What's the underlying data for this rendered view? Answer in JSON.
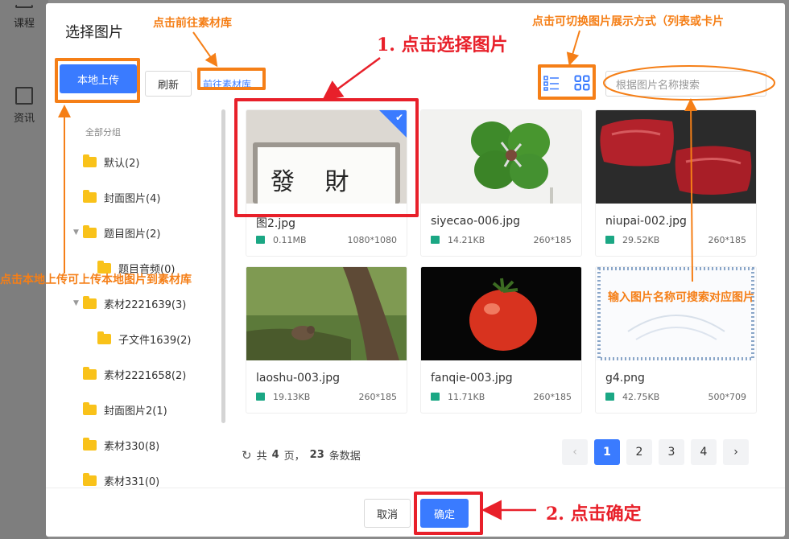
{
  "background": {
    "nav": [
      {
        "label": "课程",
        "icon": "book-icon"
      },
      {
        "label": "资讯",
        "icon": "news-icon"
      }
    ]
  },
  "modal": {
    "title": "选择图片",
    "upload_label": "本地上传",
    "refresh_label": "刷新",
    "library_link": "前往素材库",
    "search_placeholder": "根据图片名称搜索",
    "tree_header": "全部分组",
    "folders": [
      {
        "label": "默认(2)"
      },
      {
        "label": "封面图片(4)"
      },
      {
        "label": "题目图片(2)"
      },
      {
        "label": "题目音频(0)"
      },
      {
        "label": "素材2221639(3)"
      },
      {
        "label": "子文件1639(2)"
      },
      {
        "label": "素材2221658(2)"
      },
      {
        "label": "封面图片2(1)"
      },
      {
        "label": "素材330(8)"
      },
      {
        "label": "素材331(0)"
      }
    ],
    "images": [
      {
        "name": "图2.jpg",
        "size": "0.11MB",
        "dim": "1080*1080",
        "selected": true
      },
      {
        "name": "siyecao-006.jpg",
        "size": "14.21KB",
        "dim": "260*185",
        "selected": false
      },
      {
        "name": "niupai-002.jpg",
        "size": "29.52KB",
        "dim": "260*185",
        "selected": false
      },
      {
        "name": "laoshu-003.jpg",
        "size": "19.13KB",
        "dim": "260*185",
        "selected": false
      },
      {
        "name": "fanqie-003.jpg",
        "size": "11.71KB",
        "dim": "260*185",
        "selected": false
      },
      {
        "name": "g4.png",
        "size": "42.75KB",
        "dim": "500*709",
        "selected": false
      }
    ],
    "photo_text": "發 財",
    "pagination": {
      "text_prefix": "共",
      "pages": "4",
      "text_mid": "页，",
      "total": "23",
      "text_suffix": "条数据",
      "page_numbers": [
        "1",
        "2",
        "3",
        "4"
      ],
      "current": "1"
    },
    "cancel_label": "取消",
    "confirm_label": "确定"
  },
  "annotations": {
    "library_hint": "点击前往素材库",
    "view_hint": "点击可切换图片展示方式（列表或卡片",
    "step1": "1. 点击选择图片",
    "upload_hint": "点击本地上传可上传本地图片到素材库",
    "search_hint": "输入图片名称可搜索对应图片",
    "step2": "2. 点击确定"
  },
  "colors": {
    "primary": "#3a7bff",
    "annotation_red": "#e8202a",
    "annotation_orange": "#f57f17",
    "folder": "#f9c21a"
  }
}
